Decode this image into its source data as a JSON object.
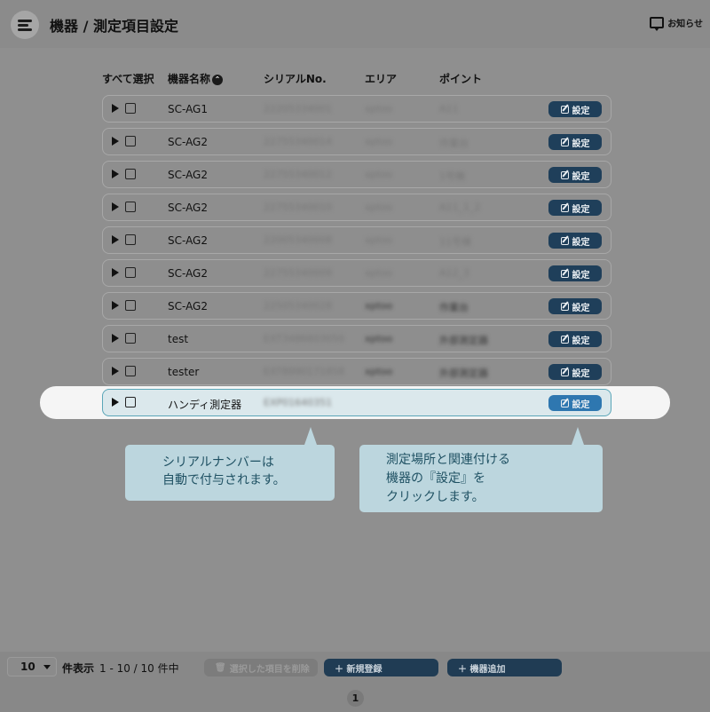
{
  "header": {
    "title": "機器 / 測定項目設定",
    "notice_label": "お知らせ"
  },
  "table": {
    "headers": {
      "select_all": "すべて選択",
      "device_name": "機器名称",
      "serial": "シリアルNo.",
      "area": "エリア",
      "point": "ポイント"
    },
    "setting_label": "設定",
    "rows": [
      {
        "name": "SC-AG1",
        "serial": "22205334001",
        "area": "xptoo",
        "point": "A11"
      },
      {
        "name": "SC-AG2",
        "serial": "22755340014",
        "area": "xptoo",
        "point": "作業台"
      },
      {
        "name": "SC-AG2",
        "serial": "22755340012",
        "area": "xptoo",
        "point": "1号機"
      },
      {
        "name": "SC-AG2",
        "serial": "22755340010",
        "area": "xptoo",
        "point": "A11_1_2"
      },
      {
        "name": "SC-AG2",
        "serial": "22005340008",
        "area": "xptoo",
        "point": "11号棟"
      },
      {
        "name": "SC-AG2",
        "serial": "22755340009",
        "area": "xptoo",
        "point": "A12_3"
      },
      {
        "name": "SC-AG2",
        "serial": "22505340028",
        "area": "xptoo",
        "point": "作業台"
      },
      {
        "name": "test",
        "serial": "EXT3486603050",
        "area": "xptoo",
        "point": "外部測定器"
      },
      {
        "name": "tester",
        "serial": "EXT8990171858",
        "area": "xptoo",
        "point": "外部測定器"
      },
      {
        "name": "ハンディ測定器",
        "serial": "EXP01640351",
        "area": "",
        "point": ""
      }
    ]
  },
  "callouts": {
    "serial_note": [
      "シリアルナンバーは",
      "自動で付与されます。"
    ],
    "setting_note": [
      "測定場所と関連付ける",
      "機器の『設定』を",
      "クリックします。"
    ]
  },
  "footer": {
    "page_size": "10",
    "per_page_label": "件表示",
    "range": "1 - 10 / 10 件中",
    "delete_selected": "選択した項目を削除",
    "new_register": "＋ 新規登録",
    "add_device": "＋ 機器追加",
    "current_page": "1"
  }
}
